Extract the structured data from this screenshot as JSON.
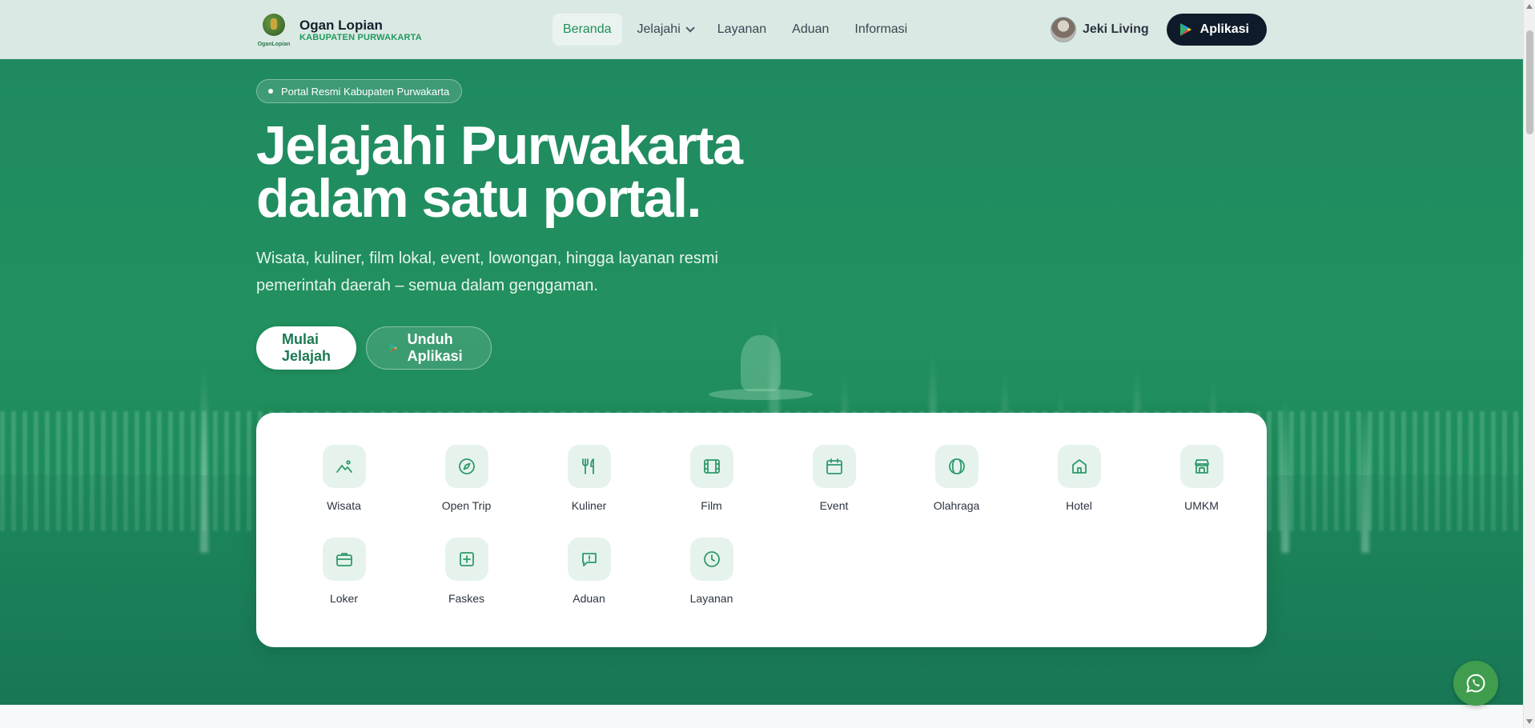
{
  "brand": {
    "logo_text": "OganLopian",
    "title": "Ogan Lopian",
    "subtitle": "KABUPATEN PURWAKARTA"
  },
  "nav": {
    "items": [
      {
        "label": "Beranda",
        "active": true
      },
      {
        "label": "Jelajahi",
        "dropdown": true
      },
      {
        "label": "Layanan"
      },
      {
        "label": "Aduan"
      },
      {
        "label": "Informasi"
      }
    ]
  },
  "user": {
    "name": "Jeki Living"
  },
  "app_button": {
    "label": "Aplikasi"
  },
  "hero": {
    "badge": "Portal Resmi Kabupaten Purwakarta",
    "headline_line1": "Jelajahi Purwakarta",
    "headline_line2": "dalam satu portal.",
    "subline_line1": "Wisata, kuliner, film lokal, event, lowongan, hingga layanan resmi",
    "subline_line2": "pemerintah daerah – semua dalam genggaman.",
    "primary_cta": "Mulai Jelajah",
    "secondary_cta": "Unduh Aplikasi"
  },
  "categories": [
    {
      "label": "Wisata",
      "icon": "mountain-icon"
    },
    {
      "label": "Open Trip",
      "icon": "compass-icon"
    },
    {
      "label": "Kuliner",
      "icon": "utensils-icon"
    },
    {
      "label": "Film",
      "icon": "film-icon"
    },
    {
      "label": "Event",
      "icon": "calendar-icon"
    },
    {
      "label": "Olahraga",
      "icon": "ball-icon"
    },
    {
      "label": "Hotel",
      "icon": "home-icon"
    },
    {
      "label": "UMKM",
      "icon": "store-icon"
    },
    {
      "label": "Loker",
      "icon": "briefcase-icon"
    },
    {
      "label": "Faskes",
      "icon": "plus-square-icon"
    },
    {
      "label": "Aduan",
      "icon": "message-alert-icon"
    },
    {
      "label": "Layanan",
      "icon": "clock-icon"
    }
  ],
  "colors": {
    "accent": "#1f8f5b",
    "hero_bg": "#22905f",
    "dark_button": "#0f1b2a",
    "icon_bg": "#e6f3ed",
    "whatsapp": "#3f9d4d"
  }
}
